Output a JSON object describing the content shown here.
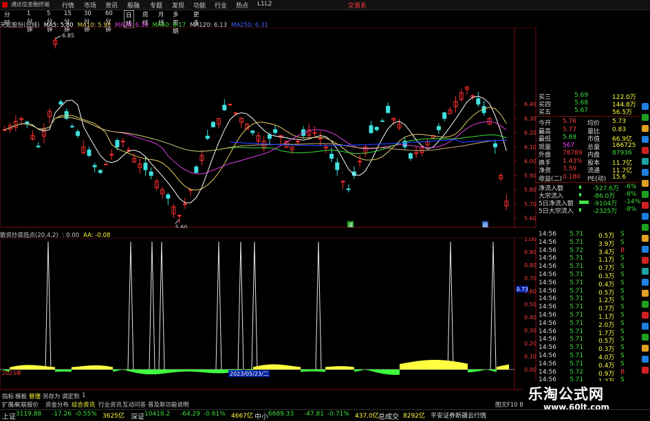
{
  "app": {
    "title": "通达信金融终端",
    "broker_link": "交易系"
  },
  "menu": [
    "行情",
    "市场",
    "资讯",
    "股融",
    "专题",
    "发现",
    "功能",
    "行业",
    "热点",
    "L1L2"
  ],
  "periods": [
    "分时",
    "1分钟",
    "5分钟",
    "15分钟",
    "30分钟",
    "60分钟",
    "日线",
    "周线",
    "月线",
    "多周期",
    "更多"
  ],
  "active_period": "日线",
  "ma_legend": [
    {
      "label": "天虹股份(日线)",
      "color": "#c8c8c8"
    },
    {
      "label": "MA5: 5.80",
      "color": "#ffffff"
    },
    {
      "label": "MA10: 5.98",
      "color": "#e8d060"
    },
    {
      "label": "MA20: 6.10",
      "color": "#e040e0"
    },
    {
      "label": "MA60: 6.17",
      "color": "#40e040"
    },
    {
      "label": "MA120: 6.13",
      "color": "#d0d0d0"
    },
    {
      "label": "MA250: 6.31",
      "color": "#4060ff"
    }
  ],
  "chart": {
    "high_label": "6.85",
    "low_label": "5.60",
    "price_axis": [
      "6.40",
      "6.30",
      "6.20",
      "6.10",
      "6.00",
      "5.90",
      "5.80",
      "5.70",
      "5.60"
    ],
    "badge_mid": "减",
    "badge_right": "融"
  },
  "indicator": {
    "legend": [
      {
        "label": "散资抄底低点(20,4,2)",
        "color": "#c8c8c8"
      },
      {
        "label": ": 0.00",
        "color": "#c8c8c8"
      },
      {
        "label": "AA: -0.08",
        "color": "#ffff40"
      }
    ],
    "axis": [
      "1.00",
      "0.90",
      "0.80",
      "0.70",
      "0.60",
      "0.50",
      "0.40",
      "0.30",
      "0.20",
      "0.10",
      "0.00"
    ],
    "cursor_value": "0.73",
    "year_label": "2023年",
    "date_label": "2023/05/23/二"
  },
  "quote": {
    "rows": [
      {
        "k": "买三",
        "v": "5.69",
        "n": "122.0万"
      },
      {
        "k": "买四",
        "v": "5.68",
        "n": "144.8万"
      },
      {
        "k": "买五",
        "v": "5.67",
        "n": "56.5万"
      }
    ],
    "stats": [
      {
        "k": "今开",
        "v": "5.76",
        "k2": "均价",
        "v2": "5.73"
      },
      {
        "k": "最高",
        "v": "5.77",
        "k2": "量比",
        "v2": "0.83"
      },
      {
        "k": "最低",
        "v": "5.69",
        "k2": "市值",
        "v2": "66.9亿"
      },
      {
        "k": "现量",
        "v": "567",
        "k2": "总量",
        "v2": "166725"
      },
      {
        "k": "外盘",
        "v": "78789",
        "k2": "内盘",
        "v2": "87936"
      },
      {
        "k": "换手",
        "v": "1.43%",
        "k2": "股本",
        "v2": "11.7亿"
      },
      {
        "k": "净资",
        "v": "3.59",
        "k2": "流通",
        "v2": "11.7亿"
      },
      {
        "k": "收益(二)",
        "v": "0.180",
        "k2": "PE(动)",
        "v2": "15.6"
      }
    ],
    "flows": [
      {
        "k": "净流入额",
        "v": "-527.6万",
        "p": "-6%"
      },
      {
        "k": "大宗流入",
        "v": "-86.0万",
        "p": "-8%"
      },
      {
        "k": "5日净流入额",
        "v": "-9104万",
        "p": "-14%"
      },
      {
        "k": "5日大宗流入",
        "v": "-2325万",
        "p": "-8%"
      }
    ]
  },
  "ticks": [
    {
      "t": "14:56",
      "p": "5.71",
      "v": "0.5万",
      "d": "S"
    },
    {
      "t": "14:56",
      "p": "5.71",
      "v": "3.9万",
      "d": "S"
    },
    {
      "t": "14:56",
      "p": "5.72",
      "v": "3.4万",
      "d": "B"
    },
    {
      "t": "14:56",
      "p": "5.71",
      "v": "1.1万",
      "d": "S"
    },
    {
      "t": "14:56",
      "p": "5.71",
      "v": "0.7万",
      "d": "S"
    },
    {
      "t": "14:56",
      "p": "5.71",
      "v": "0.3万",
      "d": "S"
    },
    {
      "t": "14:56",
      "p": "5.71",
      "v": "0.4万",
      "d": "S"
    },
    {
      "t": "14:56",
      "p": "5.71",
      "v": "0.5万",
      "d": "S"
    },
    {
      "t": "14:56",
      "p": "5.71",
      "v": "1.2万",
      "d": "S"
    },
    {
      "t": "14:56",
      "p": "5.71",
      "v": "0.7万",
      "d": "S"
    },
    {
      "t": "14:56",
      "p": "5.71",
      "v": "1.1万",
      "d": "S"
    },
    {
      "t": "14:56",
      "p": "5.71",
      "v": "2.0万",
      "d": "S"
    },
    {
      "t": "14:56",
      "p": "5.71",
      "v": "1.7万",
      "d": "S"
    },
    {
      "t": "14:56",
      "p": "5.71",
      "v": "0.5万",
      "d": "S"
    },
    {
      "t": "14:56",
      "p": "5.71",
      "v": "0.3万",
      "d": "S"
    },
    {
      "t": "14:56",
      "p": "5.71",
      "v": "4.0万",
      "d": "S"
    },
    {
      "t": "14:56",
      "p": "5.71",
      "v": "0.4万",
      "d": "S"
    },
    {
      "t": "14:56",
      "p": "5.72",
      "v": "0.9万",
      "d": "B"
    },
    {
      "t": "14:56",
      "p": "5.71",
      "v": "1.2万",
      "d": "S"
    }
  ],
  "bottom_tabs": [
    "指标",
    "模板",
    "管理",
    "另存为",
    "调定到",
    "1",
    "扩展A",
    "关联报价",
    "资金分布",
    "综合资讯",
    "行业资讯",
    "互动问答",
    "普及新功能说明"
  ],
  "status": [
    {
      "k": "上证",
      "v": "3119.88",
      "c": "-17.26",
      "p": "-0.55%",
      "a": "3625亿"
    },
    {
      "k": "深证",
      "v": "10418.2",
      "c": "-64.29",
      "p": "-0.61%",
      "a": "4667亿"
    },
    {
      "k": "中小",
      "v": "6689.33",
      "c": "-47.81",
      "p": "-0.71%",
      "a": "437.0亿"
    },
    {
      "k": "总成交",
      "v": "8292亿",
      "c": "",
      "p": "",
      "a": ""
    }
  ],
  "status_right": "平安证券新疆云行情",
  "status_hint": "图文F10 B",
  "watermark": {
    "title": "乐淘公式网",
    "url": "www.60lt.com"
  },
  "colors": {
    "up": "#ff3030",
    "down": "#40e0e0",
    "green": "#40ff40",
    "yellow": "#ffff40",
    "blue": "#2040ff"
  }
}
